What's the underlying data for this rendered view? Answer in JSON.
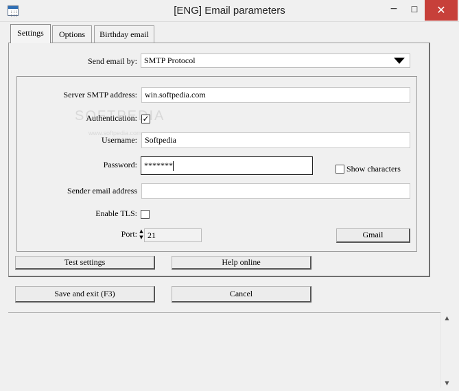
{
  "window": {
    "title": "[ENG] Email parameters",
    "minimize": "−",
    "maximize": "☐",
    "close": "✕"
  },
  "tabs": [
    {
      "label": "Settings"
    },
    {
      "label": "Options"
    },
    {
      "label": "Birthday email"
    }
  ],
  "send_email_by": {
    "label": "Send email by:",
    "value": "SMTP Protocol"
  },
  "server_smtp": {
    "label": "Server SMTP address:",
    "value": "win.softpedia.com"
  },
  "authentication": {
    "label": "Authentication:",
    "checked": true,
    "mark": "✓"
  },
  "username": {
    "label": "Username:",
    "value": "Softpedia"
  },
  "password": {
    "label": "Password:",
    "value": "*******"
  },
  "show_characters": {
    "label": "Show characters",
    "checked": false
  },
  "sender_email": {
    "label": "Sender email address",
    "value": ""
  },
  "enable_tls": {
    "label": "Enable TLS:",
    "checked": false
  },
  "port": {
    "label": "Port:",
    "value": "21"
  },
  "buttons": {
    "gmail": "Gmail",
    "test_settings": "Test settings",
    "help_online": "Help online",
    "save_exit": "Save and exit (F3)",
    "cancel": "Cancel"
  },
  "watermark": {
    "text": "SOFTPEDIA",
    "subtext": "www.softpedia.com"
  }
}
